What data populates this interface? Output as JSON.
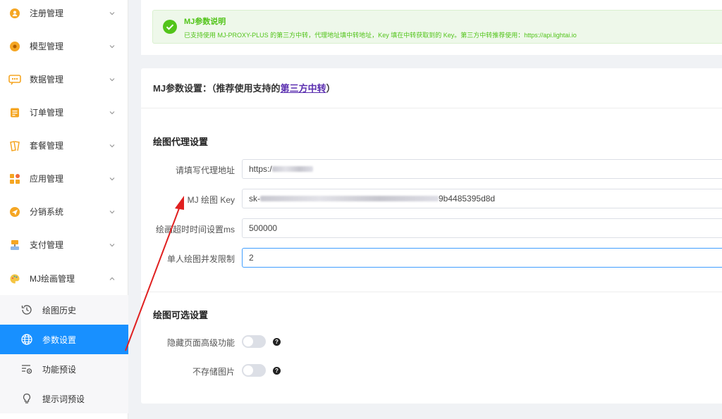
{
  "sidebar": {
    "items": [
      {
        "label": "注册管理",
        "icon": "user-plus-icon"
      },
      {
        "label": "模型管理",
        "icon": "model-icon"
      },
      {
        "label": "数据管理",
        "icon": "data-icon"
      },
      {
        "label": "订单管理",
        "icon": "order-icon"
      },
      {
        "label": "套餐管理",
        "icon": "package-icon"
      },
      {
        "label": "应用管理",
        "icon": "app-icon"
      },
      {
        "label": "分销系统",
        "icon": "distribution-icon"
      },
      {
        "label": "支付管理",
        "icon": "payment-icon"
      },
      {
        "label": "MJ绘画管理",
        "icon": "palette-icon",
        "expanded": true
      }
    ],
    "sub_items": [
      {
        "label": "绘图历史",
        "icon": "history-icon"
      },
      {
        "label": "参数设置",
        "icon": "globe-icon",
        "active": true
      },
      {
        "label": "功能预设",
        "icon": "preset-icon"
      },
      {
        "label": "提示词预设",
        "icon": "lightbulb-icon"
      }
    ]
  },
  "alert": {
    "title": "MJ参数说明",
    "description": "已支持使用 MJ-PROXY-PLUS 的第三方中转，代理地址填中转地址，Key 填在中转获取到的 Key。第三方中转推荐使用：https://api.lightai.io"
  },
  "card": {
    "title_prefix": "MJ参数设置：（推荐使用支持的",
    "title_link": "第三方中转",
    "title_suffix": "）"
  },
  "proxy_section": {
    "title": "绘图代理设置",
    "fields": {
      "proxy_url": {
        "label": "请填写代理地址",
        "value_prefix": "https:/"
      },
      "mj_key": {
        "label": "MJ 绘图 Key",
        "value_prefix": "sk-",
        "value_suffix": "9b4485395d8d"
      },
      "timeout": {
        "label": "绘画超时时间设置ms",
        "value": "500000"
      },
      "concurrency": {
        "label": "单人绘图并发限制",
        "value": "2"
      }
    }
  },
  "optional_section": {
    "title": "绘图可选设置",
    "toggles": [
      {
        "label": "隐藏页面高级功能",
        "on": false
      },
      {
        "label": "不存储图片",
        "on": false
      }
    ]
  },
  "colors": {
    "accent": "#1890ff",
    "success": "#52c41a",
    "link": "#5b2fb0",
    "annotation_arrow": "#e02020"
  }
}
